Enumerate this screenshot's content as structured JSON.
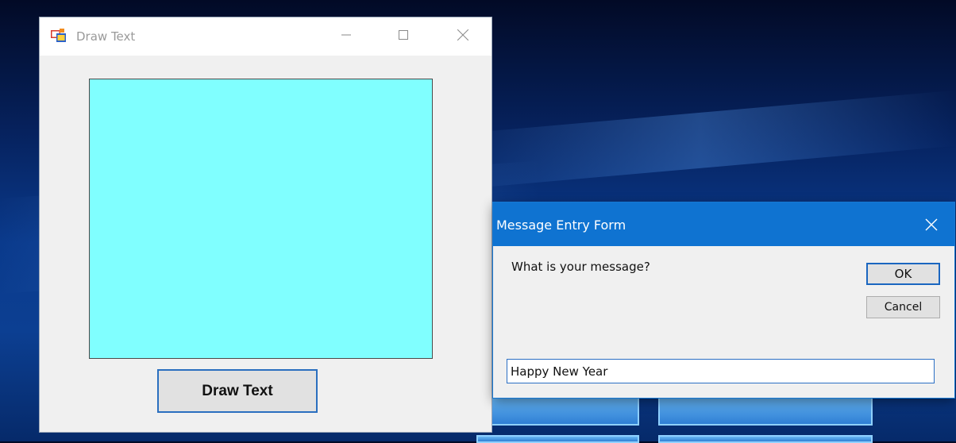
{
  "main_window": {
    "title": "Draw Text",
    "canvas_color": "#80ffff",
    "draw_button_label": "Draw Text"
  },
  "dialog": {
    "title": "Message Entry Form",
    "prompt": "What is your message?",
    "ok_label": "OK",
    "cancel_label": "Cancel",
    "message_value": "Happy New Year",
    "titlebar_color": "#0f73d1"
  },
  "icons": {
    "app_icon": "form-app-icon",
    "minimize": "minimize-icon",
    "maximize": "maximize-icon",
    "close": "close-icon"
  }
}
